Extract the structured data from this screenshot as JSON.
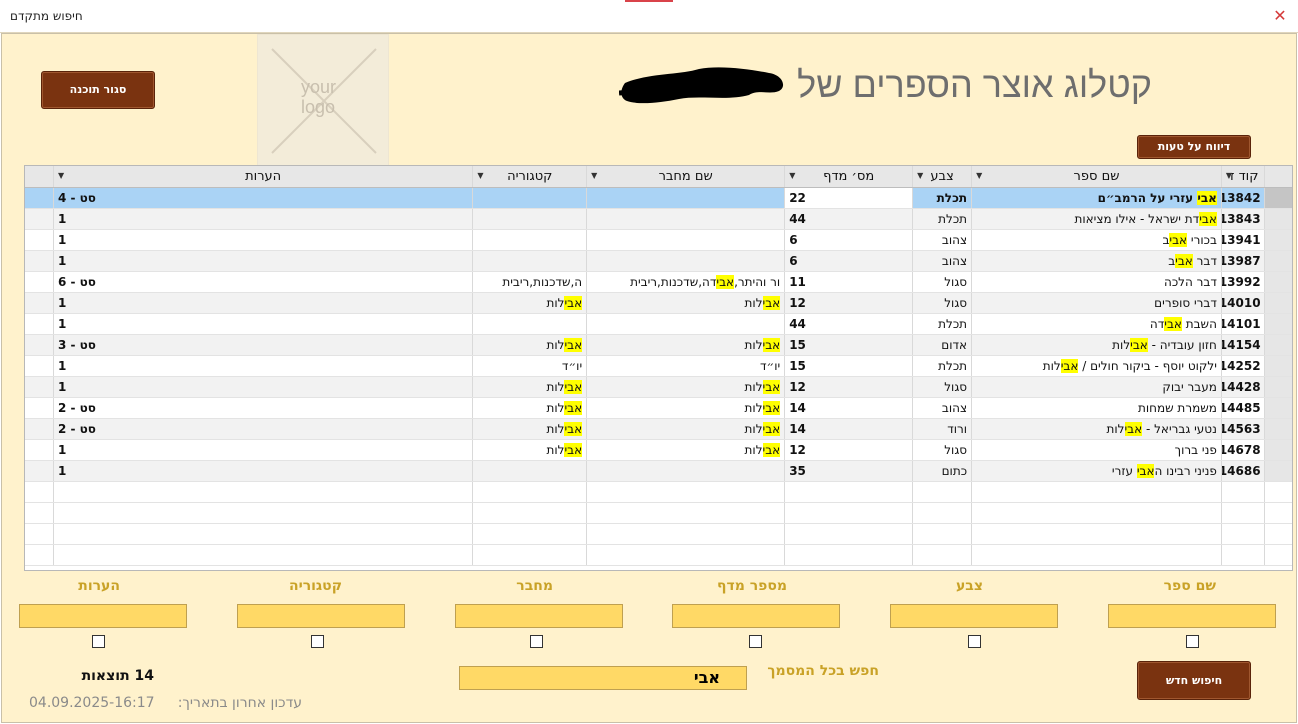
{
  "window": {
    "title": "חיפוש מתקדם"
  },
  "header": {
    "app_title": "קטלוג אוצר הספרים של",
    "logo_text_1": "your",
    "logo_text_2": "logo",
    "close_form_label": "סגור תוכנה",
    "report_error_label": "דיווח על טעות"
  },
  "table": {
    "columns": [
      "קוד זי",
      "שם ספר",
      "צבע",
      "מס׳ מדף",
      "שם מחבר",
      "קטגוריה",
      "הערות"
    ],
    "rows": [
      {
        "code": "13842",
        "title_pre": "",
        "title_hl": "אבי",
        "title_post": " עזרי על הרמב״ם",
        "color": "תכלת",
        "shelf": "22",
        "author_pre": "",
        "author_hl": "",
        "author_post": "",
        "cat_pre": "",
        "cat_hl": "",
        "cat_post": "",
        "notes": "סט - 4"
      },
      {
        "code": "13843",
        "title_pre": "",
        "title_hl": "אבי",
        "title_post": "דת ישראל - אילו מציאות",
        "color": "תכלת",
        "shelf": "44",
        "author_pre": "",
        "author_hl": "",
        "author_post": "",
        "cat_pre": "",
        "cat_hl": "",
        "cat_post": "",
        "notes": "1"
      },
      {
        "code": "13941",
        "title_pre": "בכורי ",
        "title_hl": "אבי",
        "title_post": "ב",
        "color": "צהוב",
        "shelf": "6",
        "author_pre": "",
        "author_hl": "",
        "author_post": "",
        "cat_pre": "",
        "cat_hl": "",
        "cat_post": "",
        "notes": "1"
      },
      {
        "code": "13987",
        "title_pre": "דבר ",
        "title_hl": "אבי",
        "title_post": "ב",
        "color": "צהוב",
        "shelf": "6",
        "author_pre": "",
        "author_hl": "",
        "author_post": "",
        "cat_pre": "",
        "cat_hl": "",
        "cat_post": "",
        "notes": "1"
      },
      {
        "code": "13992",
        "title_pre": "דבר הלכה",
        "title_hl": "",
        "title_post": "",
        "color": "סגול",
        "shelf": "11",
        "author_pre": "ור והיתר,",
        "author_hl": "אבי",
        "author_post": "דה,שדכנות,ריבית",
        "cat_pre": "ה,שדכנות,ריבית",
        "cat_hl": "",
        "cat_post": "",
        "notes": "סט - 6"
      },
      {
        "code": "14010",
        "title_pre": "דברי סופרים",
        "title_hl": "",
        "title_post": "",
        "color": "סגול",
        "shelf": "12",
        "author_pre": "",
        "author_hl": "אבי",
        "author_post": "לות",
        "cat_pre": "",
        "cat_hl": "אבי",
        "cat_post": "לות",
        "notes": "1"
      },
      {
        "code": "14101",
        "title_pre": "השבת ",
        "title_hl": "אבי",
        "title_post": "דה",
        "color": "תכלת",
        "shelf": "44",
        "author_pre": "",
        "author_hl": "",
        "author_post": "",
        "cat_pre": "",
        "cat_hl": "",
        "cat_post": "",
        "notes": "1"
      },
      {
        "code": "14154",
        "title_pre": "חזון עובדיה - ",
        "title_hl": "אבי",
        "title_post": "לות",
        "color": "אדום",
        "shelf": "15",
        "author_pre": "",
        "author_hl": "אבי",
        "author_post": "לות",
        "cat_pre": "",
        "cat_hl": "אבי",
        "cat_post": "לות",
        "notes": "סט - 3"
      },
      {
        "code": "14252",
        "title_pre": "ילקוט יוסף - ביקור חולים / ",
        "title_hl": "אבי",
        "title_post": "לות",
        "color": "תכלת",
        "shelf": "15",
        "author_pre": "יו״ד",
        "author_hl": "",
        "author_post": "",
        "cat_pre": "יו״ד",
        "cat_hl": "",
        "cat_post": "",
        "notes": "1"
      },
      {
        "code": "14428",
        "title_pre": "מעבר יבוק",
        "title_hl": "",
        "title_post": "",
        "color": "סגול",
        "shelf": "12",
        "author_pre": "",
        "author_hl": "אבי",
        "author_post": "לות",
        "cat_pre": "",
        "cat_hl": "אבי",
        "cat_post": "לות",
        "notes": "1"
      },
      {
        "code": "14485",
        "title_pre": "משמרת שמחות",
        "title_hl": "",
        "title_post": "",
        "color": "צהוב",
        "shelf": "14",
        "author_pre": "",
        "author_hl": "אבי",
        "author_post": "לות",
        "cat_pre": "",
        "cat_hl": "אבי",
        "cat_post": "לות",
        "notes": "סט - 2"
      },
      {
        "code": "14563",
        "title_pre": "נטעי גבריאל - ",
        "title_hl": "אבי",
        "title_post": "לות",
        "color": "ורוד",
        "shelf": "14",
        "author_pre": "",
        "author_hl": "אבי",
        "author_post": "לות",
        "cat_pre": "",
        "cat_hl": "אבי",
        "cat_post": "לות",
        "notes": "סט - 2"
      },
      {
        "code": "14678",
        "title_pre": "פני ברוך",
        "title_hl": "",
        "title_post": "",
        "color": "סגול",
        "shelf": "12",
        "author_pre": "",
        "author_hl": "אבי",
        "author_post": "לות",
        "cat_pre": "",
        "cat_hl": "אבי",
        "cat_post": "לות",
        "notes": "1"
      },
      {
        "code": "14686",
        "title_pre": "פניני רבינו ה",
        "title_hl": "אבי",
        "title_post": " עזרי",
        "color": "כתום",
        "shelf": "35",
        "author_pre": "",
        "author_hl": "",
        "author_post": "",
        "cat_pre": "",
        "cat_hl": "",
        "cat_post": "",
        "notes": "1"
      }
    ]
  },
  "filters": {
    "title_label": "שם ספר",
    "color_label": "צבע",
    "shelf_label": "מספר מדף",
    "author_label": "מחבר",
    "category_label": "קטגוריה",
    "notes_label": "הערות"
  },
  "footer": {
    "results_count": "14 תוצאות",
    "global_search_label": "חפש בכל המסמך",
    "global_search_value": "אבי",
    "new_search_label": "חיפוש חדש",
    "last_updated_label": "עדכון אחרון בתאריך:",
    "last_updated_value": "04.09.2025-16:17"
  },
  "colors": {
    "form_bg": "#fff2cc",
    "button_brown": "#7a3310",
    "label_gold": "#c9a227",
    "input_yellow": "#ffd966",
    "highlight": "#ffff00",
    "selected_row": "#aad3f5"
  }
}
